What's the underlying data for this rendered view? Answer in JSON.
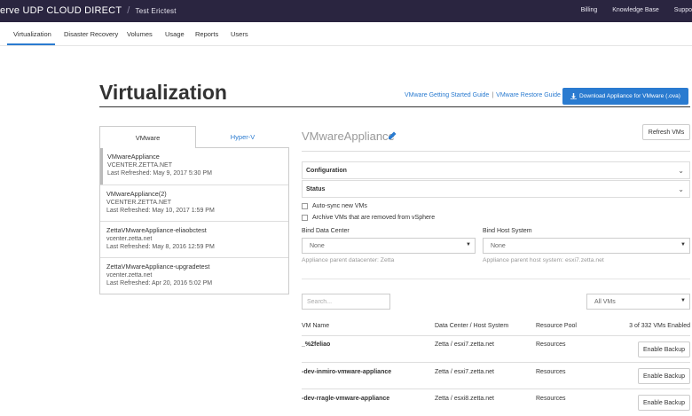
{
  "brand": {
    "name": "erve UDP CLOUD DIRECT",
    "separator": "/",
    "tenant": "Test Erictest"
  },
  "topnav": [
    "Billing",
    "Knowledge Base",
    "Suppo"
  ],
  "subnav": [
    "Virtualization",
    "Disaster Recovery",
    "Volumes",
    "Usage",
    "Reports",
    "Users"
  ],
  "page": {
    "title": "Virtualization",
    "guide1": "VMware Getting Started Guide",
    "guide_sep": "|",
    "guide2": "VMware Restore Guide",
    "download_icon": "download-icon",
    "download_label": "Download Appliance for VMware (.ova)"
  },
  "left": {
    "tabs": [
      "VMware",
      "Hyper-V"
    ],
    "items": [
      {
        "name": "VMwareAppliance",
        "host": "VCENTER.ZETTA.NET",
        "refreshed": "Last Refreshed: May 9, 2017 5:30 PM"
      },
      {
        "name": "VMwareAppliance(2)",
        "host": "VCENTER.ZETTA.NET",
        "refreshed": "Last Refreshed: May 10, 2017 1:59 PM"
      },
      {
        "name": "ZettaVMwareAppliance-eliaobctest",
        "host": "vcenter.zetta.net",
        "refreshed": "Last Refreshed: May 8, 2016 12:59 PM"
      },
      {
        "name": "ZettaVMwareAppliance-upgradetest",
        "host": "vcenter.zetta.net",
        "refreshed": "Last Refreshed: Apr 20, 2016 5:02 PM"
      }
    ]
  },
  "right": {
    "title": "VMwareAppliance",
    "edit_icon": "pencil-icon",
    "refresh_label": "Refresh VMs",
    "sections": [
      "Configuration",
      "Status"
    ],
    "checkboxes": [
      "Auto-sync new VMs",
      "Archive VMs that are removed from vSphere"
    ],
    "bind_dc": {
      "label": "Bind Data Center",
      "value": "None",
      "help": "Appliance parent datacenter: Zetta"
    },
    "bind_host": {
      "label": "Bind Host System",
      "value": "None",
      "help": "Appliance parent host system: esxi7.zetta.net"
    },
    "search_placeholder": "Search...",
    "filter_value": "All VMs"
  },
  "table": {
    "headers": {
      "vm_name": "VM Name",
      "dc_host": "Data Center  /  Host System",
      "pool": "Resource Pool",
      "count": "3 of 332 VMs Enabled"
    },
    "rows": [
      {
        "name": "_%2feliao",
        "dc": "Zetta",
        "sep": "/",
        "host": "esxi7.zetta.net",
        "pool": "Resources",
        "action": "Enable Backup"
      },
      {
        "name": "-dev-inmiro-vmware-appliance",
        "dc": "Zetta",
        "sep": "/",
        "host": "esxi7.zetta.net",
        "pool": "Resources",
        "action": "Enable Backup"
      },
      {
        "name": "-dev-rragle-vmware-appliance",
        "dc": "Zetta",
        "sep": "/",
        "host": "esxi8.zetta.net",
        "pool": "Resources",
        "action": "Enable Backup"
      }
    ]
  }
}
